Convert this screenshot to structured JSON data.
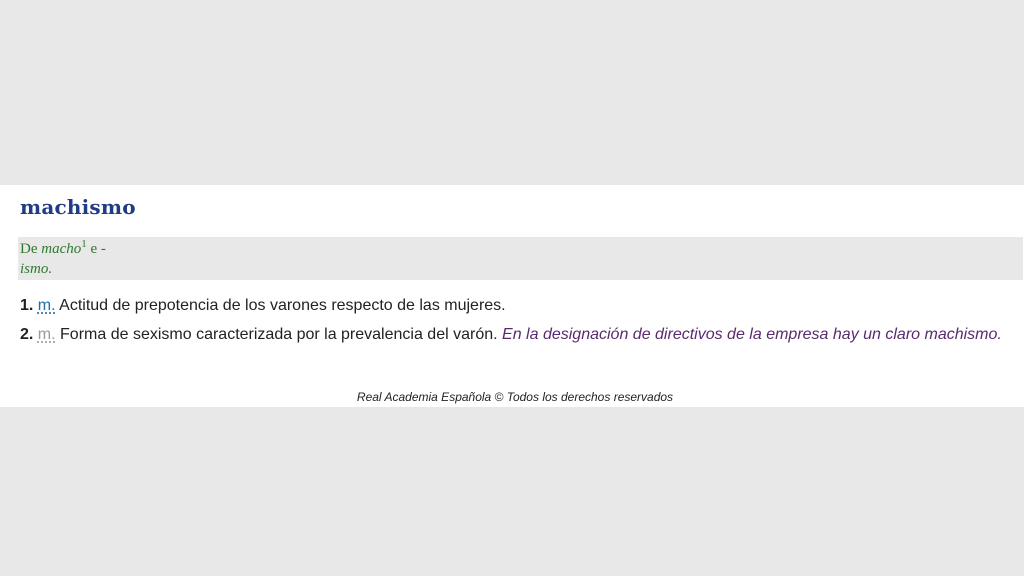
{
  "entry": {
    "headword": "machismo",
    "etymology": {
      "prefix": "De",
      "word": "macho",
      "superscript": "1",
      "connector": "e -",
      "suffix": "ismo."
    },
    "senses": [
      {
        "number": "1.",
        "abbr": "m.",
        "definition": "Actitud de prepotencia de los varones respecto de las mujeres."
      },
      {
        "number": "2.",
        "abbr": "m.",
        "definition": "Forma de sexismo caracterizada por la prevalencia del varón.",
        "example": "En la designación de directivos de la empresa hay un claro machismo."
      }
    ]
  },
  "footer": "Real Academia Española © Todos los derechos reservados",
  "colors": {
    "headword": "#1f3c84",
    "etymology": "#2d7a2d",
    "example": "#5a2a6e",
    "background": "#e8e8e8"
  }
}
